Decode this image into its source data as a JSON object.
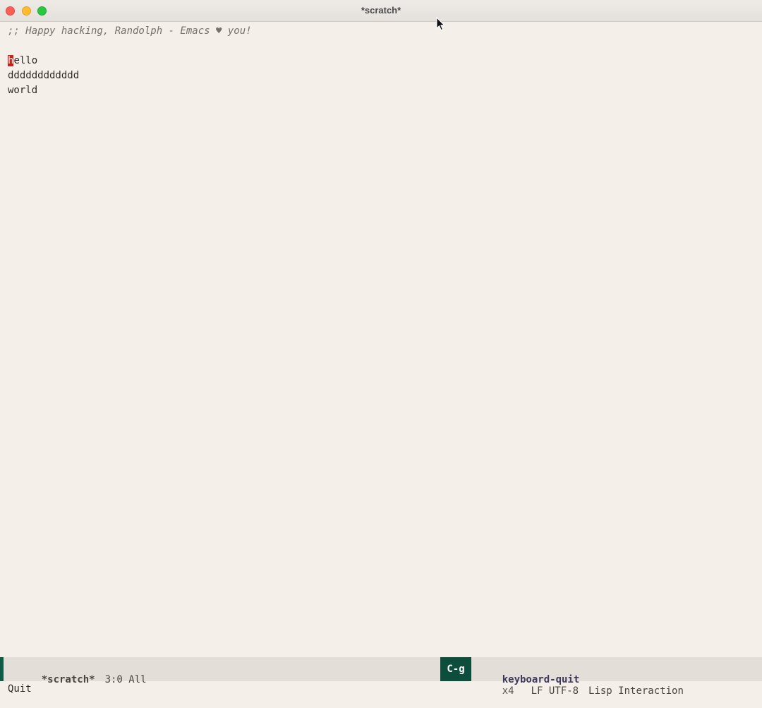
{
  "window": {
    "title": "*scratch*"
  },
  "buffer": {
    "comment_line": ";; Happy hacking, Randolph - Emacs ♥ you!",
    "line1_first_char": "h",
    "line1_rest": "ello",
    "line2": "dddddddddddd",
    "line3": "world"
  },
  "modeline": {
    "buffer_name": "*scratch*",
    "position": "3:0 All",
    "key": "C-g",
    "command": "keyboard-quit",
    "repeat_count": "x4",
    "encoding": "LF UTF-8",
    "major_mode": "Lisp Interaction"
  },
  "echo_area": {
    "message": "Quit"
  },
  "colors": {
    "background": "#f5efe9",
    "cursor": "#c6241c",
    "modeline_accent": "#0d5c46",
    "key_badge": "#0d4d3b"
  }
}
